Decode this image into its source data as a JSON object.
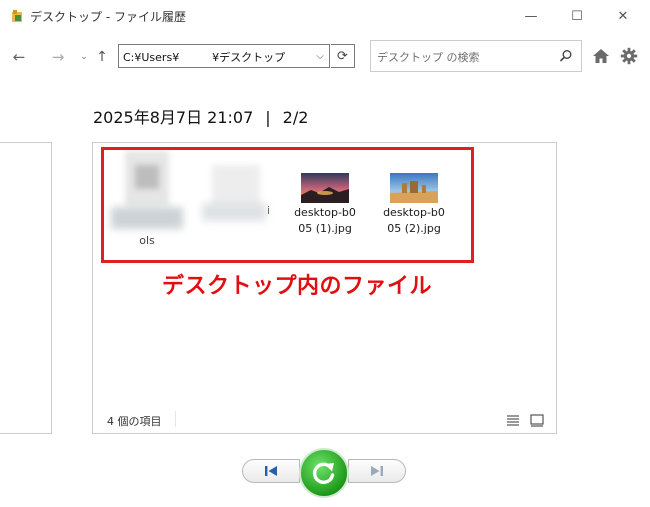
{
  "window": {
    "title": "デスクトップ - ファイル履歴",
    "minimize_glyph": "—",
    "maximize_glyph": "☐",
    "close_glyph": "✕"
  },
  "nav": {
    "back_glyph": "←",
    "forward_glyph": "→",
    "recent_glyph": "⌄",
    "up_glyph": "↑",
    "address_value": "C:¥Users¥　　　¥デスクトップ",
    "address_dropdown_glyph": "⌵",
    "refresh_glyph": "⟳"
  },
  "search": {
    "placeholder": "デスクトップ の検索"
  },
  "header": {
    "date": "2025年8月7日 21:07",
    "separator": "|",
    "position": "2/2"
  },
  "files": [
    {
      "name_line1": "",
      "name_line2": "",
      "partial_label": "ols",
      "thumbnail": "blurred-document-icon"
    },
    {
      "name_line1": "",
      "name_line2": "",
      "partial_label": "i",
      "thumbnail": "blurred-document-icon"
    },
    {
      "name_line1": "desktop-b0",
      "name_line2": "05 (1).jpg",
      "thumbnail": "sunset-landscape-image"
    },
    {
      "name_line1": "desktop-b0",
      "name_line2": "05 (2).jpg",
      "thumbnail": "desert-landscape-image"
    }
  ],
  "annotation": {
    "text": "デスクトップ内のファイル",
    "color": "#e01010"
  },
  "status": {
    "item_count": "4 個の項目"
  },
  "colors": {
    "highlight": "#e02020",
    "restore_green": "#1e9a1a",
    "control_blue": "#2a5fa8"
  }
}
